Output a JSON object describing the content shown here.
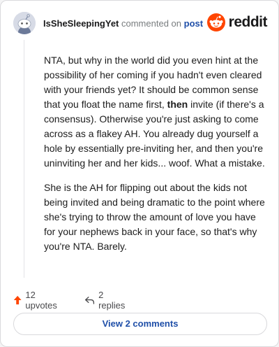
{
  "comment": {
    "username": "IsSheSleepingYet",
    "action": "commented on",
    "post_link": "post",
    "paragraph_1_before": "NTA, but why in the world did you even hint at the possibility of her coming if you hadn't even cleared with your friends yet? It should be common sense that you float the name first,",
    "paragraph_1_bold": "then",
    "paragraph_1_after": "invite (if there's a consensus). Otherwise you're just asking to come across as a flakey AH. You already dug yourself a hole by essentially pre-inviting her, and then you're uninviting her and her kids... woof. What a mistake.",
    "paragraph_2": "She is the AH for flipping out about the kids not being invited and being dramatic to the point where she's trying to throw the amount of love you have for your nephews back in your face, so that's why you're NTA. Barely."
  },
  "brand": {
    "name": "reddit",
    "icon": "reddit-logo-icon",
    "color": "#ff4500"
  },
  "footer": {
    "upvotes": "12 upvotes",
    "replies": "2 replies",
    "view_comments": "View 2 comments",
    "upvote_color": "#ff4500"
  }
}
